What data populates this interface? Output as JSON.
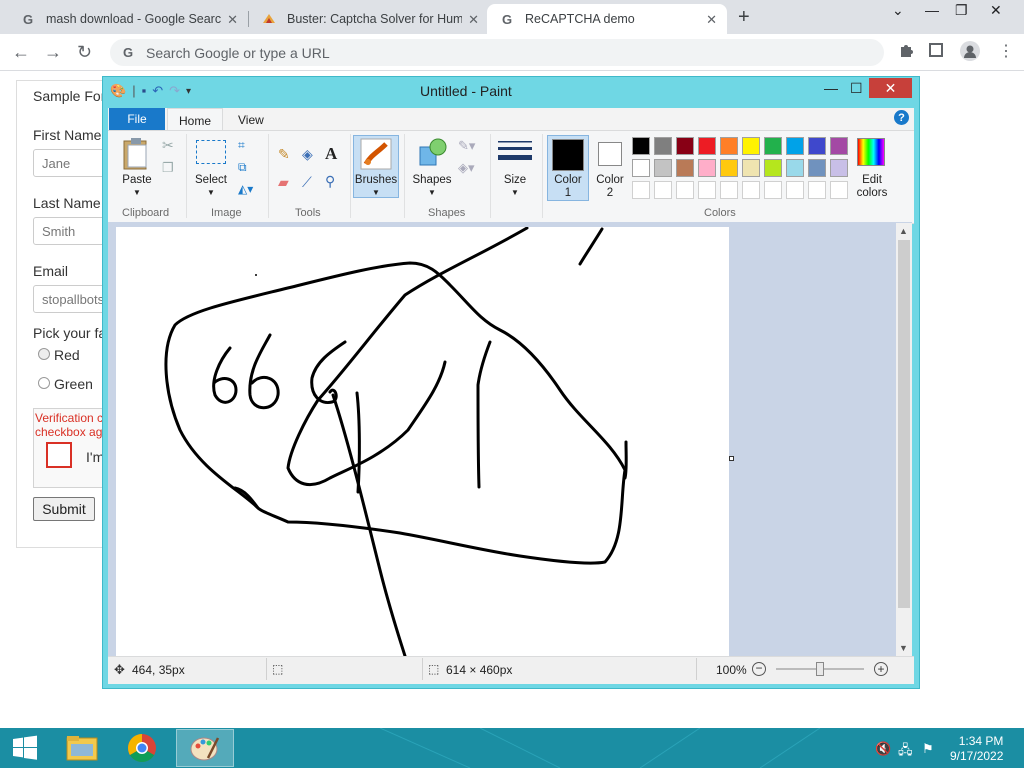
{
  "browser": {
    "tabs": [
      {
        "title": "mash download - Google Search",
        "icon": "google-icon",
        "active": false
      },
      {
        "title": "Buster: Captcha Solver for Humans",
        "icon": "buster-icon",
        "active": false
      },
      {
        "title": "ReCAPTCHA demo",
        "icon": "google-icon",
        "active": true
      }
    ],
    "omnibox_placeholder": "Search Google or type a URL"
  },
  "page": {
    "form_title": "Sample For",
    "first_name_label": "First Name",
    "first_name_value": "Jane",
    "last_name_label": "Last Name",
    "last_name_value": "Smith",
    "email_label": "Email",
    "email_value": "stopallbots",
    "pick_label": "Pick your fa",
    "radio_red": "Red",
    "radio_green": "Green",
    "verification_line1": "Verification c",
    "verification_line2": "checkbox ag",
    "im_not": "I'm",
    "submit_label": "Submit"
  },
  "paint": {
    "title": "Untitled - Paint",
    "tabs": {
      "file": "File",
      "home": "Home",
      "view": "View"
    },
    "clipboard": {
      "paste": "Paste",
      "group": "Clipboard"
    },
    "image": {
      "select": "Select",
      "group": "Image"
    },
    "tools_group": "Tools",
    "brushes": "Brushes",
    "shapes": {
      "label": "Shapes",
      "group": "Shapes"
    },
    "size": "Size",
    "color1": {
      "line1": "Color",
      "line2": "1"
    },
    "color2": {
      "line1": "Color",
      "line2": "2"
    },
    "colors_group": "Colors",
    "edit_colors": {
      "line1": "Edit",
      "line2": "colors"
    },
    "palette": [
      "#000000",
      "#7f7f7f",
      "#880015",
      "#ed1c24",
      "#ff7f27",
      "#fff200",
      "#22b14c",
      "#00a2e8",
      "#3f48cc",
      "#a349a4",
      "#ffffff",
      "#c3c3c3",
      "#b97a57",
      "#ffaec9",
      "#ffc90e",
      "#efe4b0",
      "#b5e61d",
      "#99d9ea",
      "#7092be",
      "#c8bfe7"
    ],
    "status": {
      "cursor_pos": "464, 35px",
      "canvas_size": "614 × 460px",
      "zoom": "100%"
    }
  },
  "taskbar": {
    "time": "1:34 PM",
    "date": "9/17/2022"
  }
}
